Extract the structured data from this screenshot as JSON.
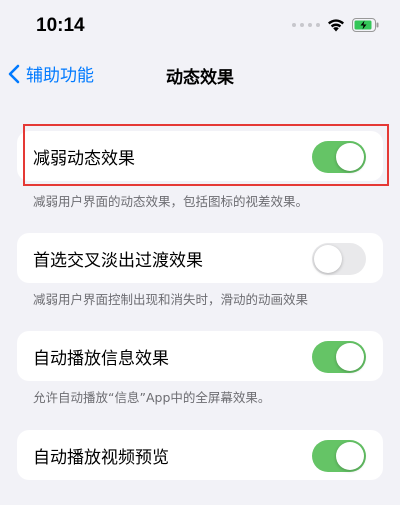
{
  "status_bar": {
    "time": "10:14"
  },
  "nav": {
    "back_label": "辅助功能",
    "title": "动态效果"
  },
  "settings": [
    {
      "label": "减弱动态效果",
      "on": true,
      "footer": "减弱用户界面的动态效果，包括图标的视差效果。"
    },
    {
      "label": "首选交叉淡出过渡效果",
      "on": false,
      "footer": "减弱用户界面控制出现和消失时，滑动的动画效果"
    },
    {
      "label": "自动播放信息效果",
      "on": true,
      "footer": "允许自动播放“信息”App中的全屏幕效果。"
    },
    {
      "label": "自动播放视频预览",
      "on": true,
      "footer": ""
    }
  ],
  "colors": {
    "accent": "#007aff",
    "toggle_on": "#65c466",
    "toggle_off": "#e9e9eb",
    "highlight": "#e53935",
    "background": "#f2f2f7"
  }
}
